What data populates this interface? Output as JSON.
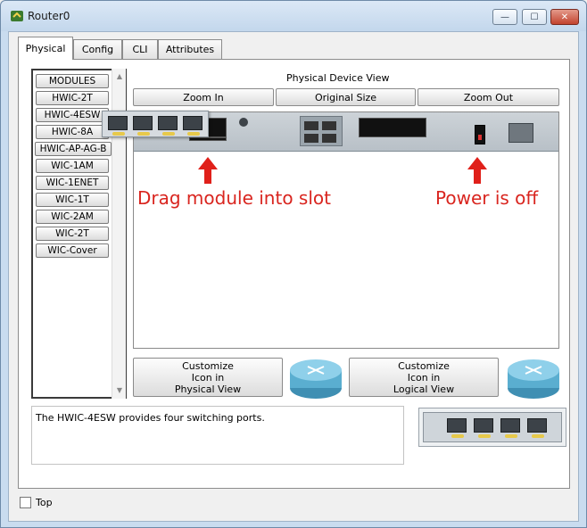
{
  "window": {
    "title": "Router0",
    "icon": "router-app-icon"
  },
  "controls": {
    "minimize": "—",
    "maximize": "☐",
    "close": "✕"
  },
  "tabs": [
    {
      "label": "Physical",
      "active": true
    },
    {
      "label": "Config",
      "active": false
    },
    {
      "label": "CLI",
      "active": false
    },
    {
      "label": "Attributes",
      "active": false
    }
  ],
  "modules": {
    "items": [
      "MODULES",
      "HWIC-2T",
      "HWIC-4ESW",
      "HWIC-8A",
      "HWIC-AP-AG-B",
      "WIC-1AM",
      "WIC-1ENET",
      "WIC-1T",
      "WIC-2AM",
      "WIC-2T",
      "WIC-Cover"
    ]
  },
  "device_view": {
    "title": "Physical Device View",
    "zoom_in": "Zoom In",
    "original_size": "Original Size",
    "zoom_out": "Zoom Out"
  },
  "annotations": {
    "left": "Drag module into slot",
    "right": "Power is off",
    "color": "#d9251f"
  },
  "customize": {
    "physical": [
      "Customize",
      "Icon in",
      "Physical View"
    ],
    "logical": [
      "Customize",
      "Icon in",
      "Logical View"
    ]
  },
  "description": "The HWIC-4ESW provides four switching ports.",
  "top_checkbox": {
    "label": "Top",
    "checked": false
  }
}
